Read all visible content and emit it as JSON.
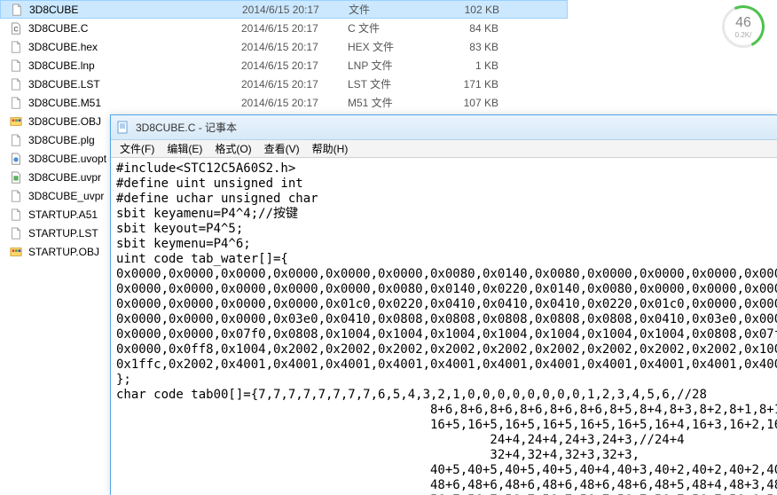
{
  "files": [
    {
      "icon": "file",
      "name": "3D8CUBE",
      "date": "2014/6/15 20:17",
      "type": "文件",
      "size": "102 KB",
      "sel": true
    },
    {
      "icon": "cfile",
      "name": "3D8CUBE.C",
      "date": "2014/6/15 20:17",
      "type": "C 文件",
      "size": "84 KB"
    },
    {
      "icon": "file",
      "name": "3D8CUBE.hex",
      "date": "2014/6/15 20:17",
      "type": "HEX 文件",
      "size": "83 KB"
    },
    {
      "icon": "file",
      "name": "3D8CUBE.lnp",
      "date": "2014/6/15 20:17",
      "type": "LNP 文件",
      "size": "1 KB"
    },
    {
      "icon": "file",
      "name": "3D8CUBE.LST",
      "date": "2014/6/15 20:17",
      "type": "LST 文件",
      "size": "171 KB"
    },
    {
      "icon": "file",
      "name": "3D8CUBE.M51",
      "date": "2014/6/15 20:17",
      "type": "M51 文件",
      "size": "107 KB"
    },
    {
      "icon": "obj",
      "name": "3D8CUBE.OBJ",
      "date": "",
      "type": "",
      "size": ""
    },
    {
      "icon": "file",
      "name": "3D8CUBE.plg",
      "date": "",
      "type": "",
      "size": ""
    },
    {
      "icon": "uvopt",
      "name": "3D8CUBE.uvopt",
      "date": "",
      "type": "",
      "size": ""
    },
    {
      "icon": "uvproj",
      "name": "3D8CUBE.uvpr",
      "date": "",
      "type": "",
      "size": ""
    },
    {
      "icon": "file",
      "name": "3D8CUBE_uvpr",
      "date": "",
      "type": "",
      "size": ""
    },
    {
      "icon": "file",
      "name": "STARTUP.A51",
      "date": "",
      "type": "",
      "size": ""
    },
    {
      "icon": "file",
      "name": "STARTUP.LST",
      "date": "",
      "type": "",
      "size": ""
    },
    {
      "icon": "obj",
      "name": "STARTUP.OBJ",
      "date": "",
      "type": "",
      "size": ""
    }
  ],
  "gauge": {
    "value": "46",
    "sub": "0.2K/"
  },
  "notepad": {
    "title": "3D8CUBE.C - 记事本",
    "menu": [
      "文件(F)",
      "编辑(E)",
      "格式(O)",
      "查看(V)",
      "帮助(H)"
    ],
    "content": "#include<STC12C5A60S2.h>\n#define uint unsigned int\n#define uchar unsigned char\nsbit keyamenu=P4^4;//按键\nsbit keyout=P4^5;\nsbit keymenu=P4^6;\nuint code tab_water[]={\n0x0000,0x0000,0x0000,0x0000,0x0000,0x0000,0x0080,0x0140,0x0080,0x0000,0x0000,0x0000,0x0000,0x\n0x0000,0x0000,0x0000,0x0000,0x0000,0x0080,0x0140,0x0220,0x0140,0x0080,0x0000,0x0000,0x0000,0x\n0x0000,0x0000,0x0000,0x0000,0x01c0,0x0220,0x0410,0x0410,0x0410,0x0220,0x01c0,0x0000,0x0000,0x\n0x0000,0x0000,0x0000,0x03e0,0x0410,0x0808,0x0808,0x0808,0x0808,0x0808,0x0410,0x03e0,0x0000,0x\n0x0000,0x0000,0x07f0,0x0808,0x1004,0x1004,0x1004,0x1004,0x1004,0x1004,0x1004,0x0808,0x07f0,0x\n0x0000,0x0ff8,0x1004,0x2002,0x2002,0x2002,0x2002,0x2002,0x2002,0x2002,0x2002,0x2002,0x1004,0x\n0x1ffc,0x2002,0x4001,0x4001,0x4001,0x4001,0x4001,0x4001,0x4001,0x4001,0x4001,0x4001,0x4001,0x\n};\nchar code tab00[]={7,7,7,7,7,7,7,7,6,5,4,3,2,1,0,0,0,0,0,0,0,0,1,2,3,4,5,6,//28\n                                          8+6,8+6,8+6,8+6,8+6,8+6,8+5,8+4,8+3,8+2,8+1,8+1,8\n                                          16+5,16+5,16+5,16+5,16+5,16+5,16+4,16+3,16+2,16+2,16+2,16+2,\n                                                  24+4,24+4,24+3,24+3,//24+4\n                                                  32+4,32+4,32+3,32+3,\n                                          40+5,40+5,40+5,40+5,40+4,40+3,40+2,40+2,40+2,40+2,\n                                          48+6,48+6,48+6,48+6,48+6,48+6,48+5,48+4,48+3,48+2,\n                                          56+7,56+7,56+7,56+7,56+7,56+7,56+7,56+7,56+6,56+5,"
  }
}
